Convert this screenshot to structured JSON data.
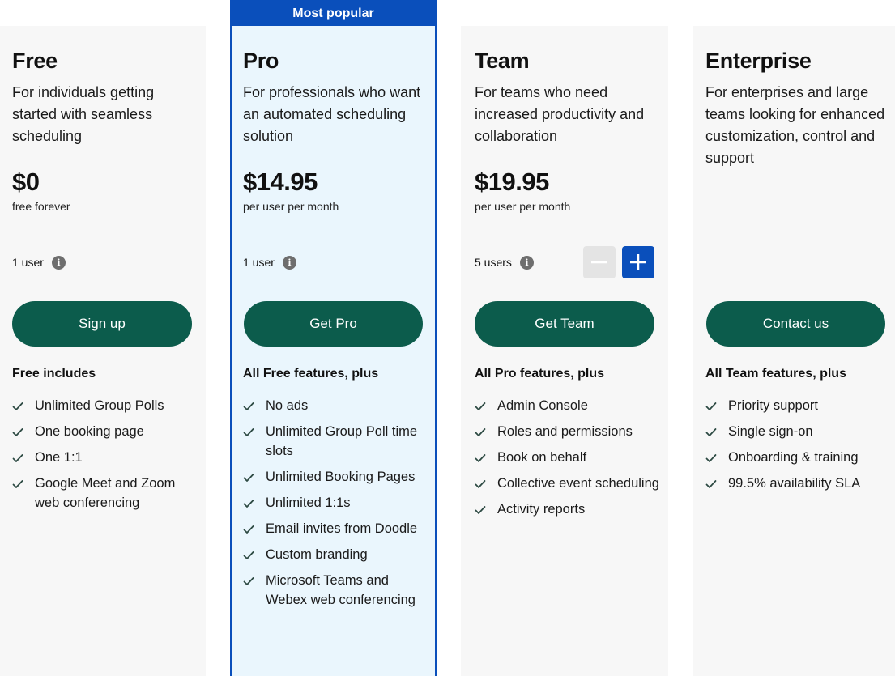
{
  "badge": {
    "label": "Most popular"
  },
  "plans": [
    {
      "id": "free",
      "name": "Free",
      "description": "For individuals getting started with seamless scheduling",
      "price": "$0",
      "price_sub": "free forever",
      "users": "1 user",
      "cta": "Sign up",
      "features_title": "Free includes",
      "features": [
        "Unlimited Group Polls",
        "One booking page",
        "One 1:1",
        "Google Meet and Zoom web conferencing"
      ]
    },
    {
      "id": "pro",
      "name": "Pro",
      "description": "For professionals who want an automated scheduling solution",
      "price": "$14.95",
      "price_sub": "per user per month",
      "users": "1 user",
      "cta": "Get Pro",
      "features_title": "All Free features, plus",
      "features": [
        "No ads",
        "Unlimited Group Poll time slots",
        "Unlimited Booking Pages",
        "Unlimited 1:1s",
        "Email invites from Doodle",
        "Custom branding",
        "Microsoft Teams and Webex web conferencing"
      ]
    },
    {
      "id": "team",
      "name": "Team",
      "description": "For teams who need increased productivity and collaboration",
      "price": "$19.95",
      "price_sub": "per user per month",
      "users": "5 users",
      "cta": "Get Team",
      "features_title": "All Pro features, plus",
      "features": [
        "Admin Console",
        "Roles and permissions",
        "Book on behalf",
        "Collective event scheduling",
        "Activity reports"
      ]
    },
    {
      "id": "enterprise",
      "name": "Enterprise",
      "description": "For enterprises and large teams looking for enhanced customization, control and support",
      "cta": "Contact us",
      "features_title": "All Team features, plus",
      "features": [
        "Priority support",
        "Single sign-on",
        "Onboarding & training",
        "99.5% availability SLA"
      ]
    }
  ],
  "icons": {
    "info": "i",
    "check": "check-icon",
    "minus": "minus-icon",
    "plus": "plus-icon"
  },
  "colors": {
    "accent_blue": "#0a4fbb",
    "cta_green": "#0c5c4c",
    "card_bg": "#f7f7f7",
    "pro_bg": "#eaf6fd",
    "check": "#2d4a43"
  }
}
